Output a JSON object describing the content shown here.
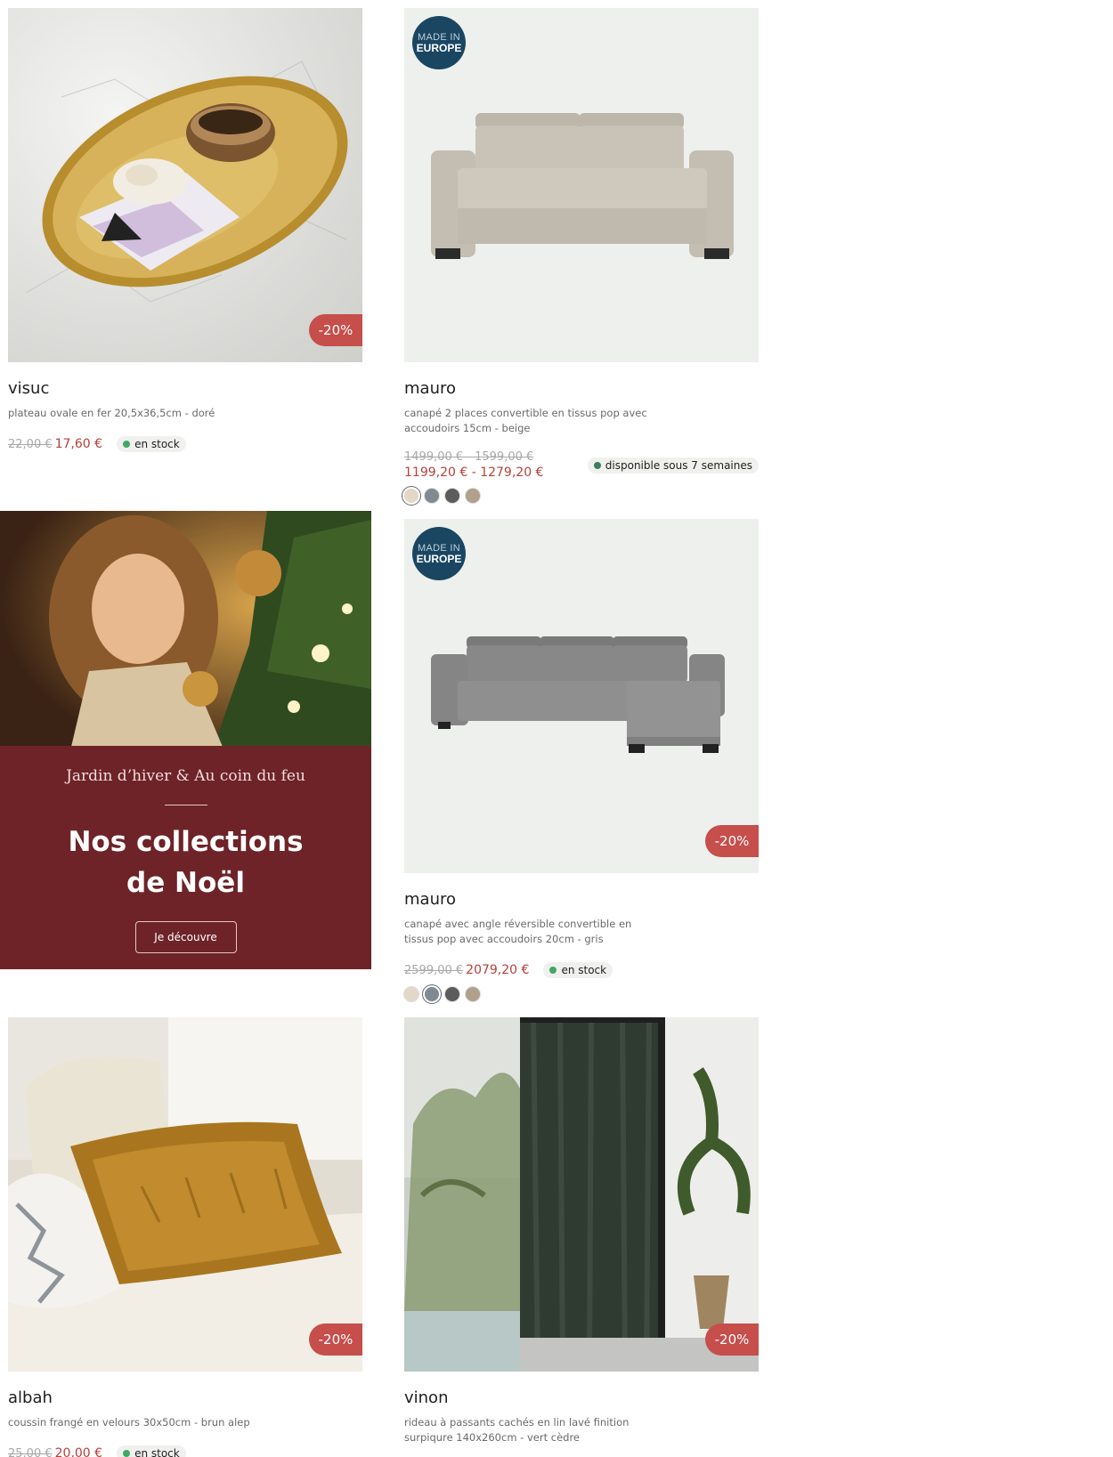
{
  "products": [
    {
      "name": "visuc",
      "description": "plateau ovale en fer 20,5x36,5cm - doré",
      "old_price": "22,00 €",
      "new_price": "17,60 €",
      "stock": "en stock",
      "discount": "-20%"
    },
    {
      "name": "mauro",
      "description": "canapé 2 places convertible en tissus pop avec accoudoirs 15cm - beige",
      "old_price": "1499,00 € - 1599,00 €",
      "new_price": "1199,20 € - 1279,20 €",
      "stock": "disponible sous 7 semaines",
      "badge_line1": "MADE IN",
      "badge_line2": "EUROPE",
      "swatches": [
        "#e3d8c7",
        "#7f8a92",
        "#5c5c5c",
        "#b0a08c"
      ],
      "selected_swatch": 0
    },
    {
      "name": "mauro",
      "description": "canapé avec angle réversible convertible en tissus pop avec accoudoirs 20cm - gris",
      "old_price": "2599,00 €",
      "new_price": "2079,20 €",
      "stock": "en stock",
      "discount": "-20%",
      "badge_line1": "MADE IN",
      "badge_line2": "EUROPE",
      "swatches": [
        "#e3d8c7",
        "#7f8a92",
        "#5c5c5c",
        "#b0a08c"
      ],
      "selected_swatch": 1
    },
    {
      "name": "albah",
      "description": "coussin frangé en velours 30x50cm - brun alep",
      "old_price": "25,00 €",
      "new_price": "20,00 €",
      "stock": "en stock",
      "discount": "-20%"
    },
    {
      "name": "vinon",
      "description": "rideau à passants cachés en lin lavé finition surpiqure 140x260cm - vert cèdre",
      "discount": "-20%"
    }
  ],
  "promo": {
    "subtitle": "Jardin d’hiver & Au coin du feu",
    "title": "Nos collections de Noël",
    "button": "Je découvre"
  }
}
